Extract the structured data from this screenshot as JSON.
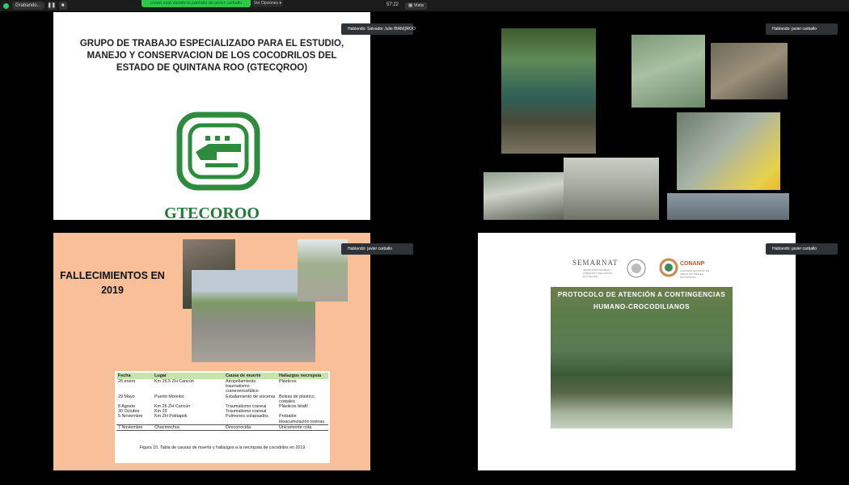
{
  "topbar": {
    "recording_label": "Grabando...",
    "pause_icon": "pause-icon",
    "stop_icon": "stop-icon",
    "share_notice": "Usted está viendo la pantalla de javier carballo",
    "share_options": "Ver Opciones",
    "clock": "57:22",
    "view_label": "Vista"
  },
  "tiles": {
    "s1": {
      "speaker": "Hablando: Salvador Julio IBANQROO",
      "title": "GRUPO DE TRABAJO ESPECIALIZADO PARA EL ESTUDIO, MANEJO Y CONSERVACION DE LOS COCODRILOS DEL ESTADO DE QUINTANA ROO (GTECQROO)",
      "brand": "GTECOROO"
    },
    "s2": {
      "speaker": "Hablando: javier carballo"
    },
    "s3": {
      "speaker": "Hablando: javier carballo",
      "title": "FALLECIMIENTOS EN 2019",
      "table": {
        "headers": [
          "Fecha",
          "Lugar",
          "Causa de muerte",
          "Hallazgos necropsia"
        ],
        "rows": [
          [
            "26 enero",
            "Km 26.5 ZH Cancún",
            "Atropellamiento traumatismo craneoencefálico",
            "Plásticos"
          ],
          [
            "29 Mayo",
            "Puerto Morelos",
            "Estallamiento de vísceras",
            "Bolsas de plástico, cristales"
          ],
          [
            "8 Agosto",
            "Km 26 ZH Cancún",
            "Traumatismo craneal",
            "Plásticos bitafil"
          ],
          [
            "30 Octubre",
            "Km 25",
            "Traumatismo craneal",
            ""
          ],
          [
            "5 Noviembre",
            "Km  ZH Poktapok",
            "Pulmones colapsados",
            "Probable bioacumulación toxinas"
          ],
          [
            "7 Noviembre",
            "Chacmochuc",
            "Desconocida",
            "Únicamente cola"
          ]
        ],
        "caption": "Figura 10. Tabla de causas de muerte y hallazgos a la necropsia de cocodrilos en 2019"
      }
    },
    "s4": {
      "speaker": "Hablando: javier carballo",
      "semarnat": "SEMARNAT",
      "semarnat_sub": "SECRETARÍA DE MEDIO AMBIENTE Y RECURSOS NATURALES",
      "conanp": "CONANP",
      "conanp_sub": "COMISIÓN NACIONAL DE ÁREAS NATURALES PROTEGIDAS",
      "title": "PROTOCOLO DE ATENCIÓN A CONTINGENCIAS HUMANO-CROCODILIANOS"
    }
  }
}
